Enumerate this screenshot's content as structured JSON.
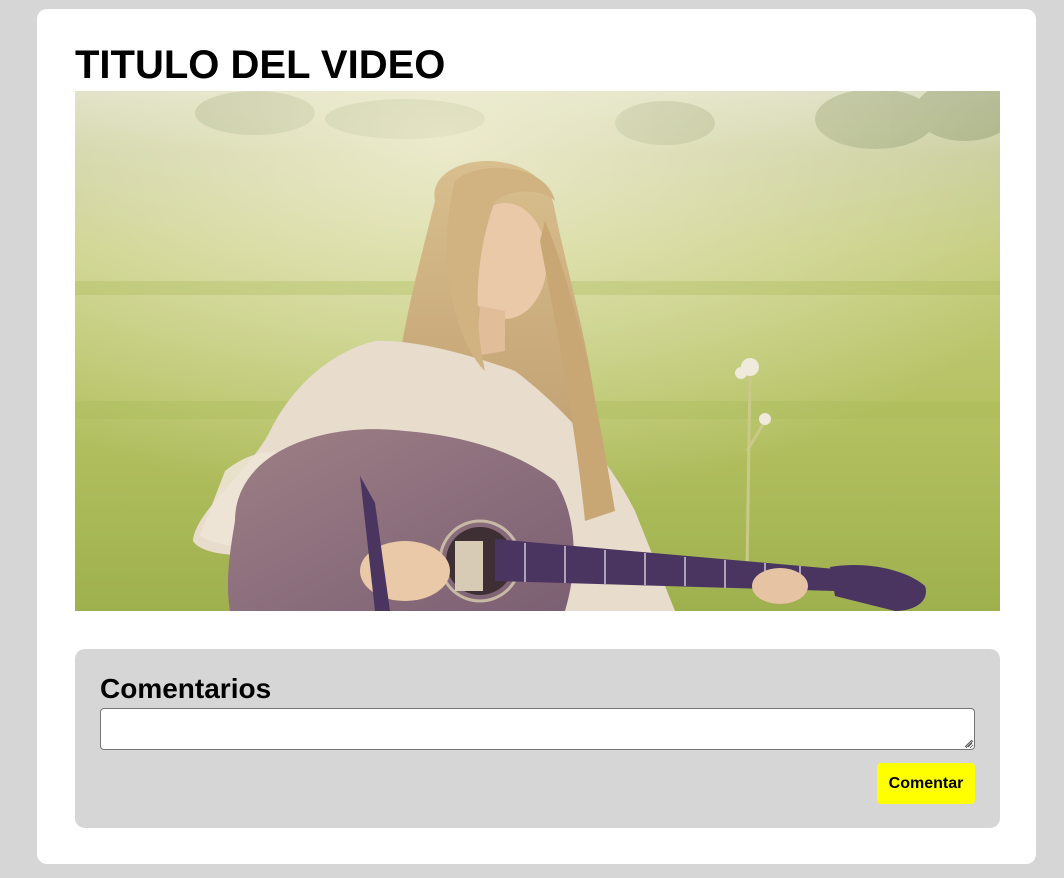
{
  "video": {
    "title": "TITULO DEL VIDEO"
  },
  "comments": {
    "heading": "Comentarios",
    "input_value": "",
    "input_placeholder": "",
    "submit_label": "Comentar"
  },
  "colors": {
    "page_background": "#d6d6d6",
    "card_background": "#ffffff",
    "comments_panel_background": "#d6d6d6",
    "button_background": "#ffff00"
  }
}
